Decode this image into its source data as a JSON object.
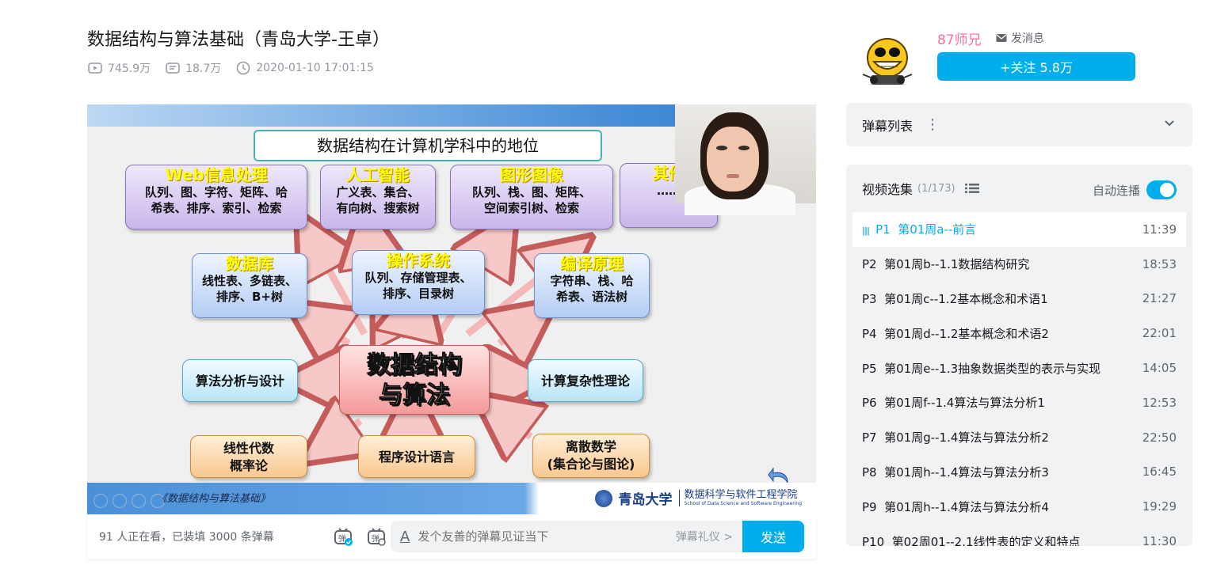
{
  "video": {
    "title": "数据结构与算法基础（青岛大学-王卓）",
    "views": "745.9万",
    "danmaku_count": "18.7万",
    "publish_time": "2020-01-10 17:01:15"
  },
  "slide": {
    "title": "数据结构在计算机学科中的地位",
    "caption": "《数据结构与算法基础》",
    "school_name": "青岛大学",
    "school_sub_cn": "数据科学与软件工程学院",
    "school_sub_en": "School of Data Science and Software Engineering",
    "boxes": {
      "web_head": "Web信息处理",
      "web_line1": "队列、图、字符、矩阵、哈",
      "web_line2": "希表、排序、索引、检索",
      "ai_head": "人工智能",
      "ai_line1": "广义表、集合、",
      "ai_line2": "有向树、搜索树",
      "graph_head": "图形图像",
      "graph_line1": "队列、栈、图、矩阵、",
      "graph_line2": "空间索引树、检索",
      "other_head": "其他",
      "other_line1": "……",
      "db_head": "数据库",
      "db_line1": "线性表、多链表、",
      "db_line2": "排序、B+树",
      "os_head": "操作系统",
      "os_line1": "队列、存储管理表、",
      "os_line2": "排序、目录树",
      "compiler_head": "编译原理",
      "compiler_line1": "字符串、栈、哈",
      "compiler_line2": "希表、语法树",
      "algo_analysis": "算法分析与设计",
      "center_line1": "数据结构",
      "center_line2": "与算法",
      "complexity": "计算复杂性理论",
      "linear_line1": "线性代数",
      "linear_line2": "概率论",
      "programming": "程序设计语言",
      "discrete_line1": "离散数学",
      "discrete_line2": "(集合论与图论)"
    }
  },
  "danmaku_bar": {
    "viewers": "91 人正在看，已装填 3000 条弹幕",
    "input_placeholder": "发个友善的弹幕见证当下",
    "etiquette": "弹幕礼仪 >",
    "send": "发送",
    "input_icon": "A"
  },
  "uploader": {
    "name": "87师兄",
    "message": "发消息",
    "follow": "+关注 5.8万"
  },
  "danmaku_list": {
    "title": "弹幕列表",
    "more": "⋮"
  },
  "episodes": {
    "title": "视频选集",
    "count": "(1/173)",
    "autoplay": "自动连播",
    "autoplay_on": true,
    "items": [
      {
        "label": "P1  第01周a--前言",
        "duration": "11:39",
        "active": true
      },
      {
        "label": "P2  第01周b--1.1数据结构研究",
        "duration": "18:53"
      },
      {
        "label": "P3  第01周c--1.2基本概念和术语1",
        "duration": "21:27"
      },
      {
        "label": "P4  第01周d--1.2基本概念和术语2",
        "duration": "22:01"
      },
      {
        "label": "P5  第01周e--1.3抽象数据类型的表示与实现",
        "duration": "14:05"
      },
      {
        "label": "P6  第01周f--1.4算法与算法分析1",
        "duration": "12:53"
      },
      {
        "label": "P7  第01周g--1.4算法与算法分析2",
        "duration": "22:50"
      },
      {
        "label": "P8  第01周h--1.4算法与算法分析3",
        "duration": "16:45"
      },
      {
        "label": "P9  第01周h--1.4算法与算法分析4",
        "duration": "19:29"
      },
      {
        "label": "P10  第02周01--2.1线性表的定义和特点",
        "duration": "11:30"
      }
    ]
  },
  "colors": {
    "accent": "#00aeec",
    "uploader_name": "#fb7299",
    "panel_bg": "#f1f2f3"
  }
}
